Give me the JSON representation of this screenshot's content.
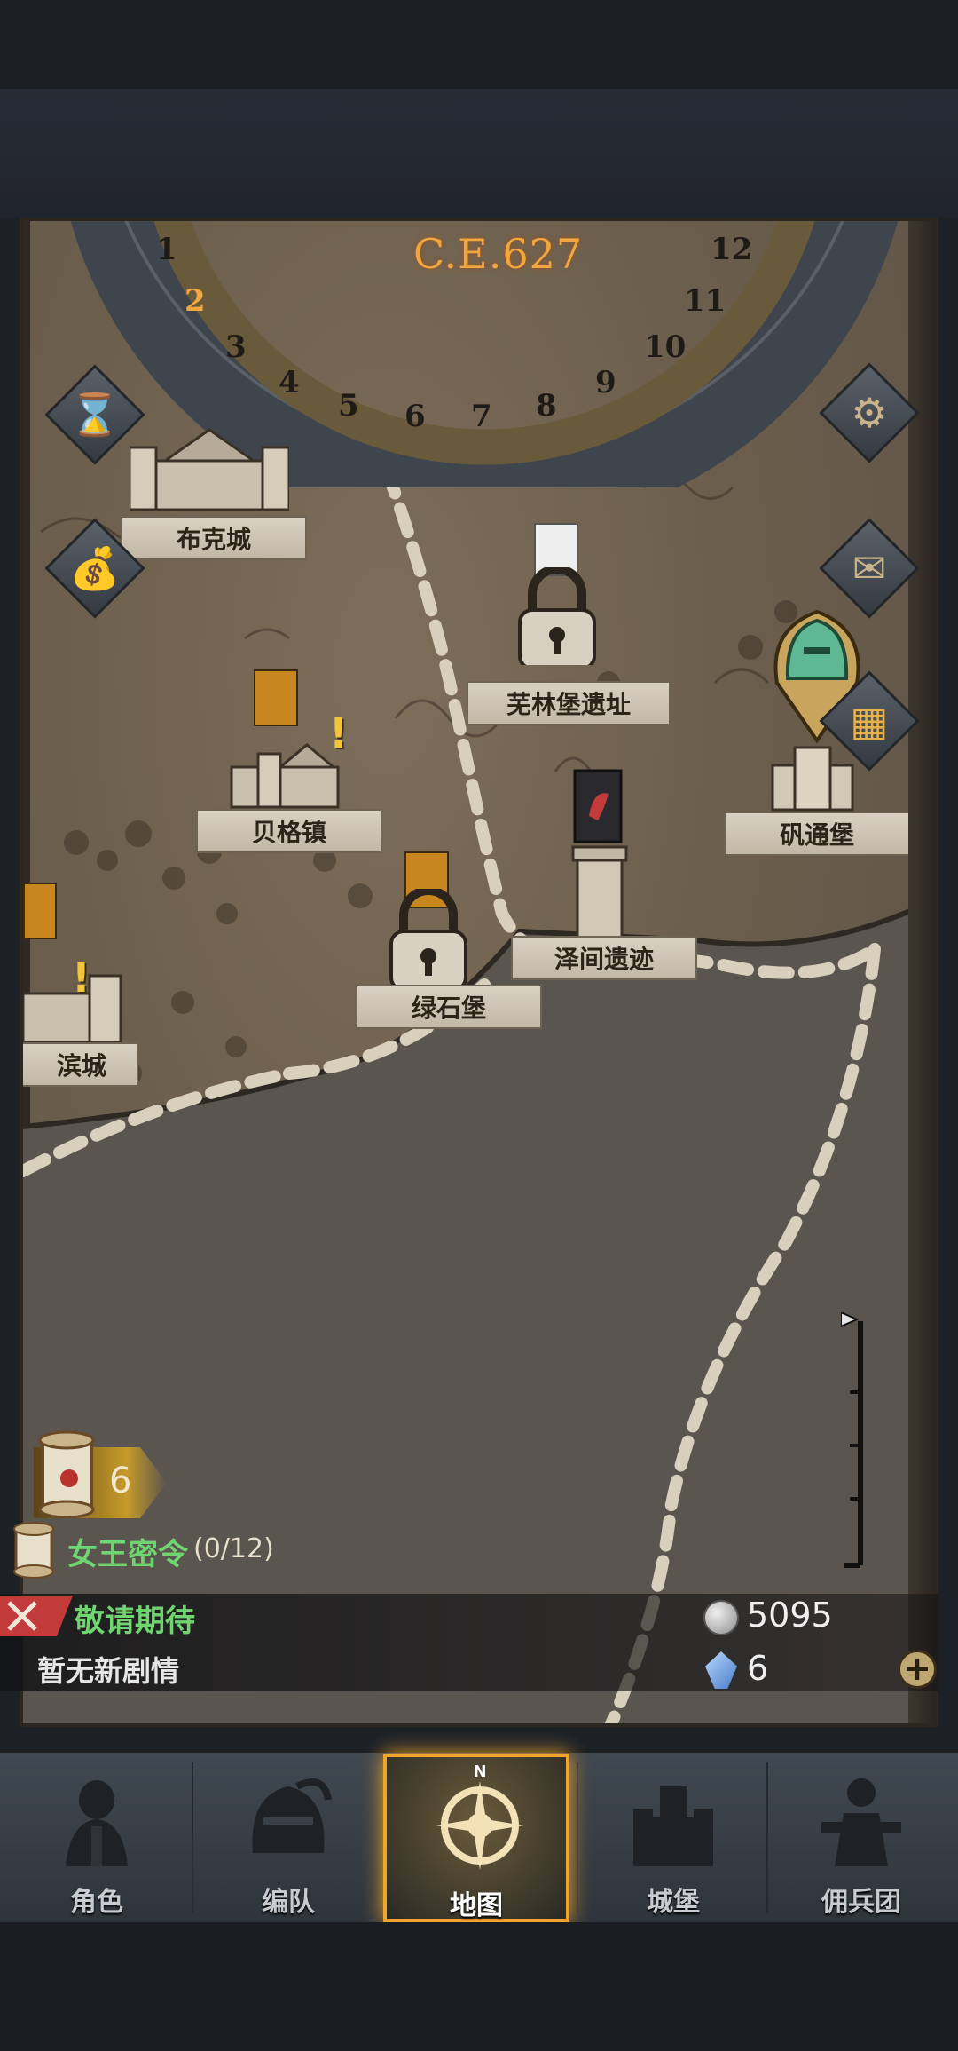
{
  "calendar": {
    "year": "C.E.627",
    "months": [
      "1",
      "2",
      "3",
      "4",
      "5",
      "6",
      "7",
      "8",
      "9",
      "10",
      "11",
      "12"
    ],
    "current_month": "2"
  },
  "locations": {
    "buke": "布克城",
    "wulin": "芜林堡遗址",
    "beige": "贝格镇",
    "fantong": "矾通堡",
    "zejian": "泽间遗迹",
    "lvshi": "绿石堡",
    "binchen": "滨城"
  },
  "side_buttons": {
    "left": [
      "hourglass-icon",
      "money-bag-icon"
    ],
    "right": [
      "gear-icon",
      "mail-icon",
      "calendar-grid-icon"
    ]
  },
  "quest": {
    "count": "6",
    "queen_title": "女王密令",
    "queen_progress": "(0/12)"
  },
  "story": {
    "title": "敬请期待",
    "subtitle": "暂无新剧情"
  },
  "resources": {
    "silver": "5095",
    "crystal": "6"
  },
  "tabs": [
    {
      "label": "角色",
      "icon": "knight-icon"
    },
    {
      "label": "编队",
      "icon": "helmet-icon"
    },
    {
      "label": "地图",
      "icon": "compass-icon",
      "active": true
    },
    {
      "label": "城堡",
      "icon": "castle-icon"
    },
    {
      "label": "佣兵团",
      "icon": "mercenary-icon"
    }
  ],
  "compass_north": "N",
  "colors": {
    "accent": "#f0a62a",
    "quest_green": "#70d470",
    "year": "#f2a640"
  }
}
